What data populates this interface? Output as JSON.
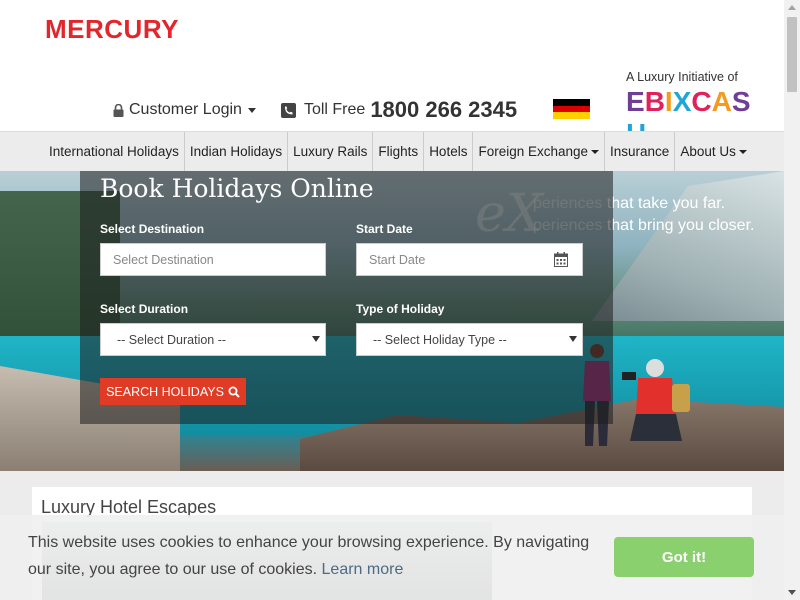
{
  "header": {
    "logo": "MERCURY",
    "customer_login": "Customer Login",
    "toll_free_label": "Toll Free",
    "toll_free_number": "1800 266 2345",
    "partner_tagline": "A Luxury Initiative of",
    "partner_logo": "EBIXCASH"
  },
  "nav": {
    "items": [
      {
        "label": "International Holidays"
      },
      {
        "label": "Indian Holidays"
      },
      {
        "label": "Luxury Rails"
      },
      {
        "label": "Flights"
      },
      {
        "label": "Hotels"
      },
      {
        "label": "Foreign Exchange"
      },
      {
        "label": "Insurance"
      },
      {
        "label": "About Us"
      }
    ]
  },
  "hero": {
    "title": "Book Holidays Online",
    "tagline_line1_a": "periences",
    "tagline_line1_b": "that take you far.",
    "tagline_line2_a": "periences",
    "tagline_line2_b": "that bring you closer.",
    "tagline_mark": "eX"
  },
  "form": {
    "destination_label": "Select Destination",
    "destination_placeholder": "Select Destination",
    "start_date_label": "Start Date",
    "start_date_placeholder": "Start Date",
    "duration_label": "Select Duration",
    "duration_value": "-- Select Duration --",
    "holiday_type_label": "Type of Holiday",
    "holiday_type_value": "-- Select Holiday Type --",
    "search_button": "SEARCH HOLIDAYS"
  },
  "section": {
    "title": "Luxury Hotel Escapes"
  },
  "cookie": {
    "message": "This website uses cookies to enhance your browsing experience. By navigating our site, you agree to our use of cookies.",
    "learn_more": "Learn more",
    "accept": "Got it!"
  },
  "colors": {
    "brand_red": "#e3262b",
    "search_button": "#e03c25",
    "accept_button": "#8bd06f",
    "nav_bg": "#ececec"
  }
}
